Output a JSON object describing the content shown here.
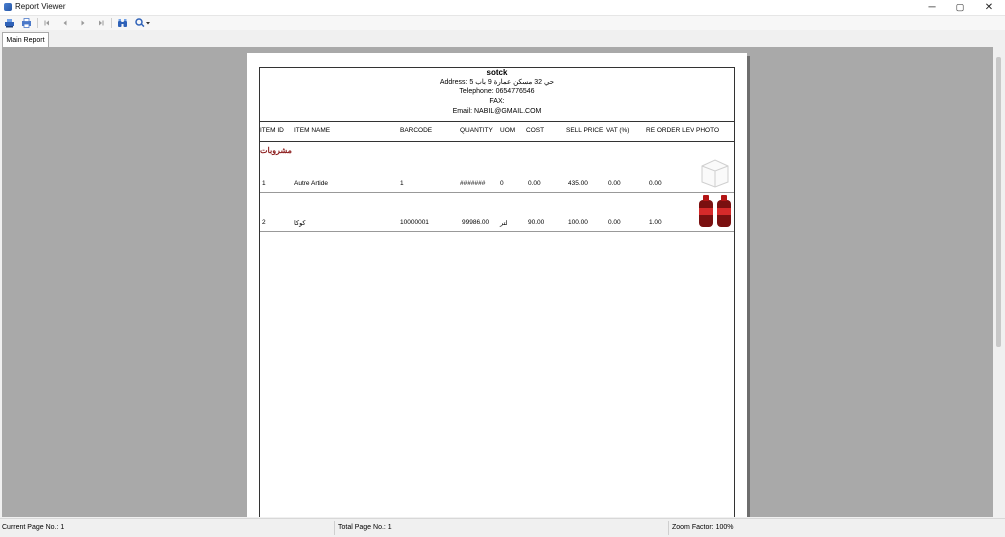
{
  "window": {
    "title": "Report Viewer",
    "controls": {
      "minimize": "─",
      "maximize": "▢",
      "close": "✕"
    }
  },
  "toolbar": {
    "items": [
      "print-setup-icon",
      "print-icon",
      "first-page-icon",
      "previous-page-icon",
      "next-page-icon",
      "last-page-icon",
      "find-icon",
      "zoom-icon"
    ]
  },
  "tabs": [
    {
      "label": "Main Report",
      "selected": true
    }
  ],
  "report": {
    "header": {
      "title": "sotck",
      "address": "Address: 5 حي 32 مسكن عمارة 9 باب",
      "telephone": "Telephone: 0654776546",
      "fax": "FAX:",
      "email": "Email: NABIL@GMAIL.COM"
    },
    "columns": [
      "ITEM ID",
      "ITEM NAME",
      "BARCODE",
      "QUANTITY",
      "UOM",
      "COST",
      "SELL PRICE",
      "VAT (%)",
      "RE ORDER LEVI",
      "PHOTO"
    ],
    "category": "مشروبات",
    "rows": [
      {
        "id": "1",
        "name": "Autre Artide",
        "barcode": "1",
        "quantity": "#######",
        "uom": "0",
        "cost": "0.00",
        "sell": "435.00",
        "vat": "0.00",
        "reorder": "0.00",
        "photo": "placeholder-box-icon"
      },
      {
        "id": "2",
        "name": "كوكا",
        "barcode": "10000001",
        "quantity": "99986.00",
        "uom": "لتر",
        "cost": "90.00",
        "sell": "100.00",
        "vat": "0.00",
        "reorder": "1.00",
        "photo": "cola-bottles-image"
      }
    ]
  },
  "status": {
    "current_page": "Current Page No.: 1",
    "total_page": "Total Page No.: 1",
    "zoom": "Zoom Factor: 100%"
  },
  "colors": {
    "category": "#8b1a1a",
    "viewport_bg": "#a9a9a9",
    "icon_blue": "#2f62b8"
  }
}
